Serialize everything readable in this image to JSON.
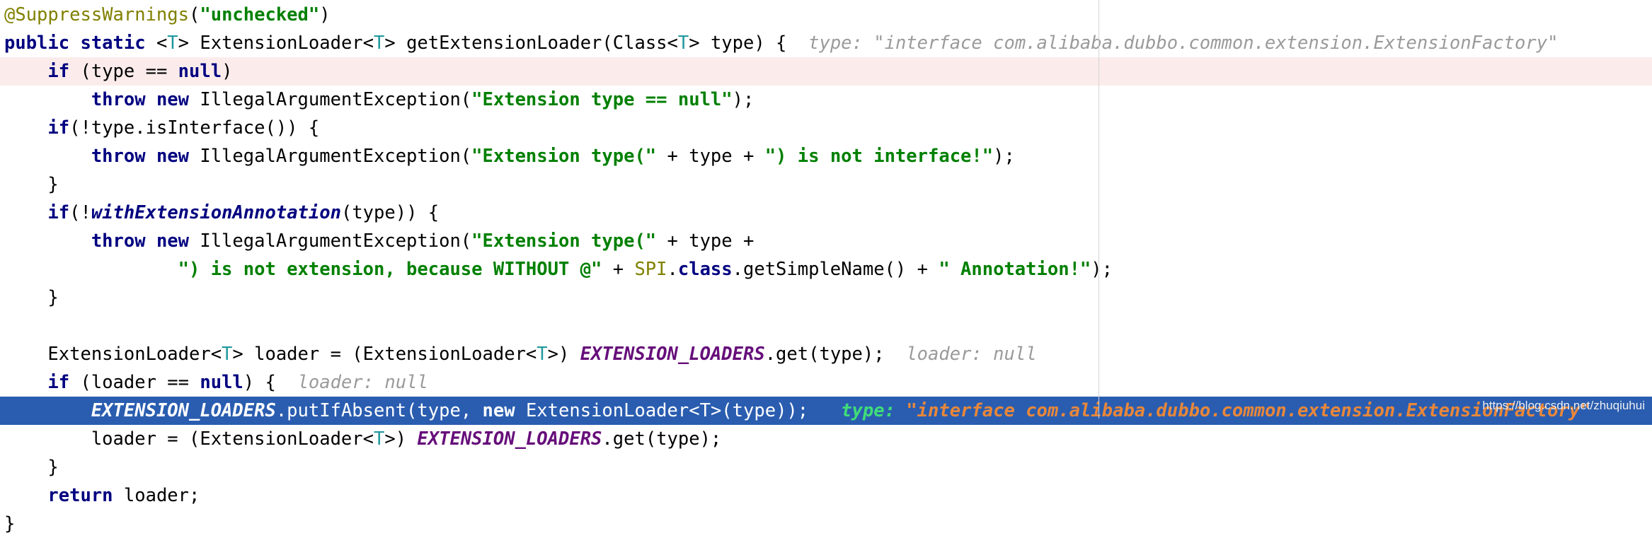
{
  "editor": {
    "language": "Java",
    "margin_guide_x": 1552,
    "colors": {
      "background": "#ffffff",
      "keyword": "#000080",
      "string": "#008000",
      "annotation": "#808000",
      "static_field": "#660e7a",
      "type_parameter": "#20999d",
      "inline_hint": "#9a9a9a",
      "selection_background": "#2a5db0",
      "selection_text": "#ffffff",
      "selection_hint_label": "#3fdd78",
      "selection_hint_value": "#e8873a",
      "execution_line_background": "#fbeceb",
      "margin_guide": "#d4d4d4",
      "watermark": "#eceff1"
    },
    "lines": [
      {
        "id": "line-annotation",
        "state": "normal",
        "text": "@SuppressWarnings(\"unchecked\")",
        "segments": [
          {
            "t": "@SuppressWarnings",
            "c": "anno"
          },
          {
            "t": "(",
            "c": "punct"
          },
          {
            "t": "\"unchecked\"",
            "c": "str"
          },
          {
            "t": ")",
            "c": "punct"
          }
        ]
      },
      {
        "id": "line-signature",
        "state": "normal",
        "text": "public static <T> ExtensionLoader<T> getExtensionLoader(Class<T> type) {",
        "hint": "type: \"interface com.alibaba.dubbo.common.extension.ExtensionFactory\"",
        "segments": [
          {
            "t": "public static ",
            "c": "kw"
          },
          {
            "t": "<",
            "c": "punct"
          },
          {
            "t": "T",
            "c": "typeparam"
          },
          {
            "t": "> ExtensionLoader<",
            "c": "ident"
          },
          {
            "t": "T",
            "c": "typeparam"
          },
          {
            "t": "> getExtensionLoader(Class<",
            "c": "ident"
          },
          {
            "t": "T",
            "c": "typeparam"
          },
          {
            "t": "> type) {",
            "c": "ident"
          }
        ]
      },
      {
        "id": "line-if-type-null",
        "state": "exec-pink",
        "text": "    if (type == null)",
        "segments": [
          {
            "t": "    ",
            "c": "ident"
          },
          {
            "t": "if",
            "c": "kw"
          },
          {
            "t": " (type == ",
            "c": "ident"
          },
          {
            "t": "null",
            "c": "kw"
          },
          {
            "t": ")",
            "c": "ident"
          }
        ]
      },
      {
        "id": "line-throw-null",
        "state": "normal",
        "text": "        throw new IllegalArgumentException(\"Extension type == null\");",
        "segments": [
          {
            "t": "        ",
            "c": "ident"
          },
          {
            "t": "throw new",
            "c": "kw"
          },
          {
            "t": " IllegalArgumentException(",
            "c": "ident"
          },
          {
            "t": "\"Extension type == null\"",
            "c": "str"
          },
          {
            "t": ");",
            "c": "ident"
          }
        ]
      },
      {
        "id": "line-if-isinterface",
        "state": "normal",
        "text": "    if(!type.isInterface()) {",
        "segments": [
          {
            "t": "    ",
            "c": "ident"
          },
          {
            "t": "if",
            "c": "kw"
          },
          {
            "t": "(!type.isInterface()) {",
            "c": "ident"
          }
        ]
      },
      {
        "id": "line-throw-not-interface",
        "state": "normal",
        "text": "        throw new IllegalArgumentException(\"Extension type(\" + type + \") is not interface!\");",
        "segments": [
          {
            "t": "        ",
            "c": "ident"
          },
          {
            "t": "throw new",
            "c": "kw"
          },
          {
            "t": " IllegalArgumentException(",
            "c": "ident"
          },
          {
            "t": "\"Extension type(\"",
            "c": "str"
          },
          {
            "t": " + type + ",
            "c": "ident"
          },
          {
            "t": "\") is not interface!\"",
            "c": "str"
          },
          {
            "t": ");",
            "c": "ident"
          }
        ]
      },
      {
        "id": "line-close-brace-1",
        "state": "normal",
        "text": "    }",
        "segments": [
          {
            "t": "    }",
            "c": "ident"
          }
        ]
      },
      {
        "id": "line-if-withextensionannotation",
        "state": "normal",
        "text": "    if(!withExtensionAnnotation(type)) {",
        "segments": [
          {
            "t": "    ",
            "c": "ident"
          },
          {
            "t": "if",
            "c": "kw"
          },
          {
            "t": "(!",
            "c": "ident"
          },
          {
            "t": "withExtensionAnnotation",
            "c": "method-it"
          },
          {
            "t": "(type)) {",
            "c": "ident"
          }
        ]
      },
      {
        "id": "line-throw-not-extension-a",
        "state": "normal",
        "text": "        throw new IllegalArgumentException(\"Extension type(\" + type +",
        "segments": [
          {
            "t": "        ",
            "c": "ident"
          },
          {
            "t": "throw new",
            "c": "kw"
          },
          {
            "t": " IllegalArgumentException(",
            "c": "ident"
          },
          {
            "t": "\"Extension type(\"",
            "c": "str"
          },
          {
            "t": " + type +",
            "c": "ident"
          }
        ]
      },
      {
        "id": "line-throw-not-extension-b",
        "state": "normal",
        "text": "                \") is not extension, because WITHOUT @\" + SPI.class.getSimpleName() + \" Annotation!\");",
        "segments": [
          {
            "t": "                ",
            "c": "ident"
          },
          {
            "t": "\") is not extension, because WITHOUT @\"",
            "c": "str"
          },
          {
            "t": " + ",
            "c": "ident"
          },
          {
            "t": "SPI",
            "c": "classref"
          },
          {
            "t": ".",
            "c": "ident"
          },
          {
            "t": "class",
            "c": "kw"
          },
          {
            "t": ".getSimpleName() + ",
            "c": "ident"
          },
          {
            "t": "\" Annotation!\"",
            "c": "str"
          },
          {
            "t": ");",
            "c": "ident"
          }
        ]
      },
      {
        "id": "line-close-brace-2",
        "state": "normal",
        "text": "    }",
        "segments": [
          {
            "t": "    }",
            "c": "ident"
          }
        ]
      },
      {
        "id": "line-blank-1",
        "state": "normal",
        "text": "",
        "segments": []
      },
      {
        "id": "line-loader-assign",
        "state": "normal",
        "text": "    ExtensionLoader<T> loader = (ExtensionLoader<T>) EXTENSION_LOADERS.get(type);",
        "hint": "loader: null",
        "segments": [
          {
            "t": "    ExtensionLoader<",
            "c": "ident"
          },
          {
            "t": "T",
            "c": "typeparam"
          },
          {
            "t": "> loader = (ExtensionLoader<",
            "c": "ident"
          },
          {
            "t": "T",
            "c": "typeparam"
          },
          {
            "t": ">) ",
            "c": "ident"
          },
          {
            "t": "EXTENSION_LOADERS",
            "c": "staticfld"
          },
          {
            "t": ".get(type);",
            "c": "ident"
          }
        ]
      },
      {
        "id": "line-if-loader-null",
        "state": "normal",
        "text": "    if (loader == null) {",
        "hint": "loader: null",
        "segments": [
          {
            "t": "    ",
            "c": "ident"
          },
          {
            "t": "if",
            "c": "kw"
          },
          {
            "t": " (loader == ",
            "c": "ident"
          },
          {
            "t": "null",
            "c": "kw"
          },
          {
            "t": ") {",
            "c": "ident"
          }
        ]
      },
      {
        "id": "line-putifabsent",
        "state": "selected",
        "text": "        EXTENSION_LOADERS.putIfAbsent(type, new ExtensionLoader<T>(type));",
        "hint_label": "type:",
        "hint_value": "\"interface com.alibaba.dubbo.common.extension.ExtensionFactory\"",
        "segments": [
          {
            "t": "        ",
            "c": "ident"
          },
          {
            "t": "EXTENSION_LOADERS",
            "c": "staticfld"
          },
          {
            "t": ".putIfAbsent(type, ",
            "c": "ident"
          },
          {
            "t": "new",
            "c": "kw"
          },
          {
            "t": " ExtensionLoader<",
            "c": "ident"
          },
          {
            "t": "T",
            "c": "typeparam"
          },
          {
            "t": ">(type));",
            "c": "ident"
          }
        ]
      },
      {
        "id": "line-loader-reassign",
        "state": "normal",
        "text": "        loader = (ExtensionLoader<T>) EXTENSION_LOADERS.get(type);",
        "segments": [
          {
            "t": "        loader = (ExtensionLoader<",
            "c": "ident"
          },
          {
            "t": "T",
            "c": "typeparam"
          },
          {
            "t": ">) ",
            "c": "ident"
          },
          {
            "t": "EXTENSION_LOADERS",
            "c": "staticfld"
          },
          {
            "t": ".get(type);",
            "c": "ident"
          }
        ]
      },
      {
        "id": "line-close-brace-3",
        "state": "normal",
        "text": "    }",
        "segments": [
          {
            "t": "    }",
            "c": "ident"
          }
        ]
      },
      {
        "id": "line-return",
        "state": "normal",
        "text": "    return loader;",
        "segments": [
          {
            "t": "    ",
            "c": "ident"
          },
          {
            "t": "return",
            "c": "kw"
          },
          {
            "t": " loader;",
            "c": "ident"
          }
        ]
      },
      {
        "id": "line-close-method",
        "state": "normal",
        "text": "}",
        "segments": [
          {
            "t": "}",
            "c": "ident"
          }
        ]
      }
    ]
  },
  "watermark": {
    "text": "https://blog.csdn.net/zhuqiuhui"
  }
}
